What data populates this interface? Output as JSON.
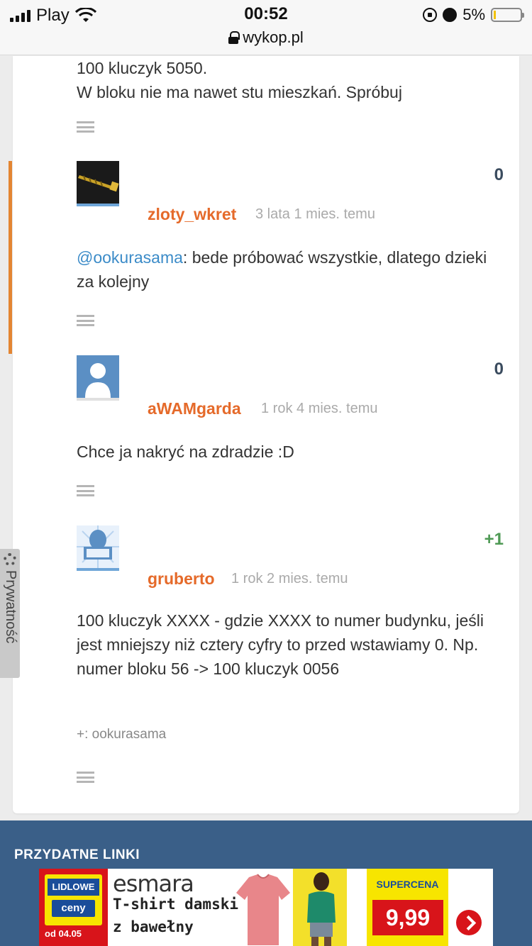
{
  "status_bar": {
    "carrier": "Play",
    "time": "00:52",
    "url": "wykop.pl",
    "battery": "5%"
  },
  "top_text": [
    "100 kluczyk 5050.",
    "W bloku nie ma nawet stu mieszkań. Spróbuj"
  ],
  "comments": [
    {
      "author": "zloty_wkret",
      "time": "3 lata 1 mies. temu",
      "score": "0",
      "mention": "@ookurasama",
      "body": ": bede próbować wszystkie, dlatego dzieki za kolejny"
    },
    {
      "author": "aWAMgarda",
      "time": "1 rok 4 mies. temu",
      "score": "0",
      "body": "Chce ja nakryć na zdradzie :D"
    },
    {
      "author": "gruberto",
      "time": "1 rok 2 mies. temu",
      "score": "+1",
      "body": "100 kluczyk XXXX - gdzie XXXX to numer budynku, jeśli jest mniejszy niż cztery cyfry to przed wstawiamy 0. Np. numer bloku 56 -> 100 kluczyk 0056",
      "voters_prefix": "+:",
      "voters": "ookurasama"
    }
  ],
  "privacy_tab": "Prywatność",
  "footer": {
    "title": "PRZYDATNE LINKI"
  },
  "ad": {
    "badge_line1": "LIDLOWE",
    "badge_line2": "ceny",
    "date": "od 04.05",
    "brand": "esmara",
    "desc_line1": "T-shirt damski",
    "desc_line2": "z bawełny",
    "promo_label": "SUPERCENA",
    "price": "9,99"
  },
  "colors": {
    "accent": "#e38532",
    "author": "#e56a2a",
    "mention": "#3b8bc8",
    "footer": "#3a5f88",
    "positive_score": "#4f9a55"
  }
}
